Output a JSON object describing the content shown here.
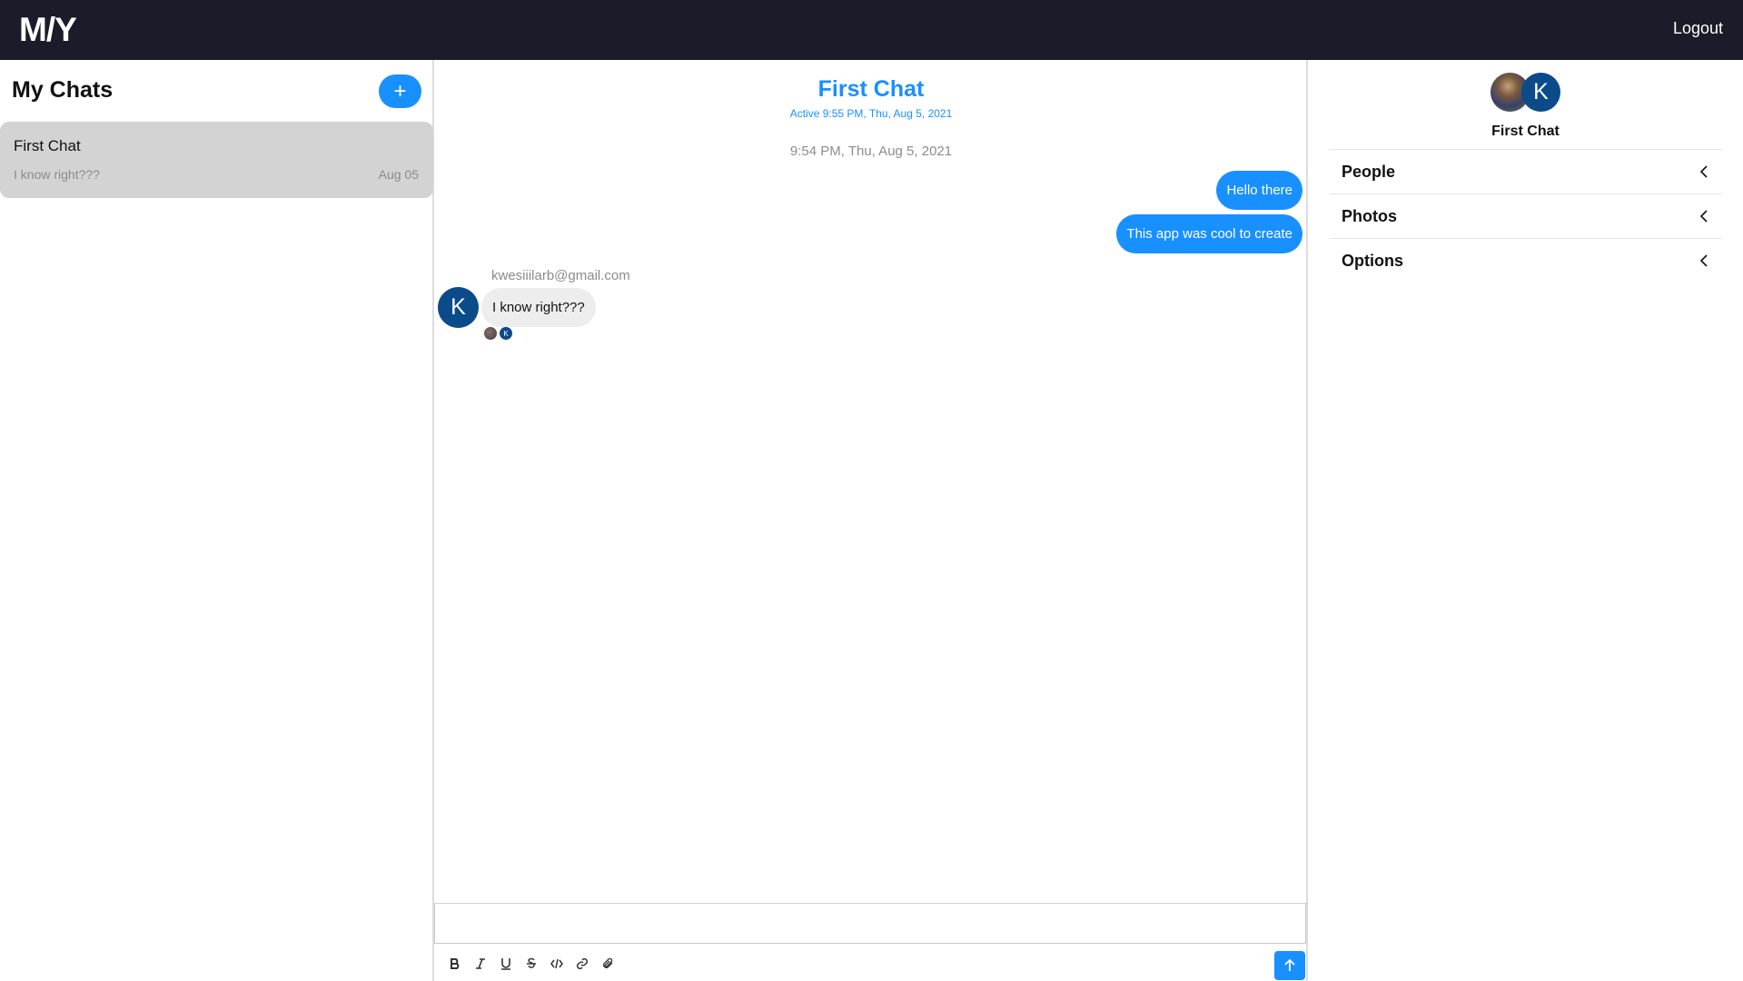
{
  "app": {
    "logo": "M/Y",
    "logout_label": "Logout"
  },
  "chat_list": {
    "title": "My Chats",
    "new_chat_label": "+",
    "items": [
      {
        "title": "First Chat",
        "preview": "I know right???",
        "date": "Aug 05"
      }
    ]
  },
  "feed": {
    "title": "First Chat",
    "subtitle": "Active 9:55 PM, Thu, Aug 5, 2021",
    "timestamp": "9:54 PM, Thu, Aug 5, 2021",
    "messages": [
      {
        "text": "Hello there",
        "mine": true
      },
      {
        "text": "This app was cool to create",
        "mine": true
      },
      {
        "text": "I know right???",
        "mine": false,
        "sender": "kwesiiilarb@gmail.com",
        "avatar_letter": "K"
      }
    ],
    "read_receipt_letter": "K",
    "composer": {
      "placeholder": "",
      "tools": [
        "bold-icon",
        "italic-icon",
        "underline-icon",
        "strikethrough-icon",
        "code-icon",
        "link-icon",
        "attachment-icon"
      ],
      "send_icon": "arrow-up-icon"
    }
  },
  "settings": {
    "title": "First Chat",
    "avatar_letter": "K",
    "sections": [
      "People",
      "Photos",
      "Options"
    ]
  },
  "colors": {
    "accent": "#1890ff",
    "topbar": "#1b1b29",
    "avatar": "#0b4b8a",
    "selected_card": "#d3d3d3"
  }
}
